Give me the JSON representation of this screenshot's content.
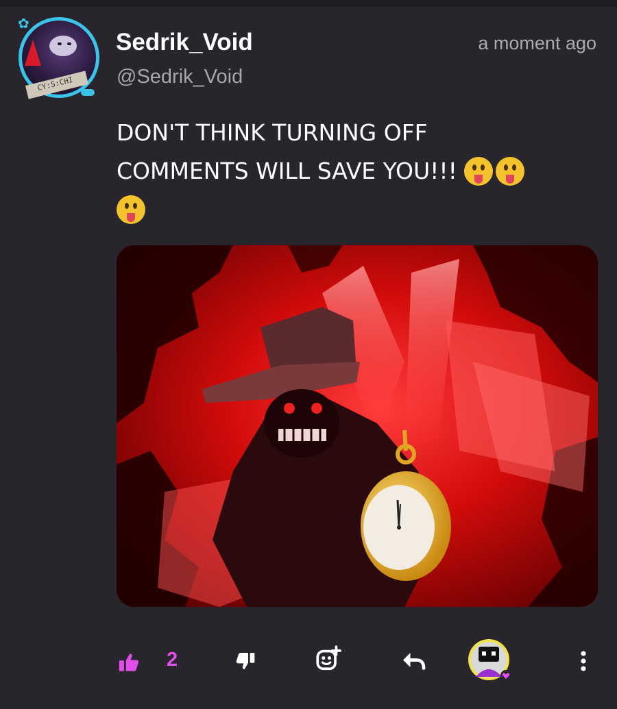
{
  "post": {
    "display_name": "Sedrik_Void",
    "handle": "@Sedrik_Void",
    "timestamp": "a moment ago",
    "text_line1": "DON'T THINK TURNING OFF",
    "text_line2": "COMMENTS WILL SAVE YOU!!!",
    "emoji": "😛",
    "avatar_tag_text": "CY:S:CHI"
  },
  "actions": {
    "like_count": "2",
    "icons": [
      "thumbs-up-icon",
      "thumbs-down-icon",
      "add-reaction-icon",
      "reply-icon",
      "reactor-avatar",
      "more-options-icon"
    ]
  },
  "colors": {
    "background": "#28262c",
    "accent_like": "#e14eea",
    "avatar_ring": "#3bc3ea",
    "muted_text": "#a9a7ad"
  }
}
